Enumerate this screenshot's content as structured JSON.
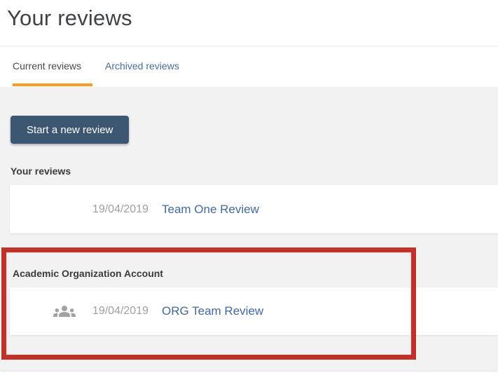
{
  "page": {
    "title": "Your reviews"
  },
  "tabs": [
    {
      "label": "Current reviews",
      "active": true
    },
    {
      "label": "Archived reviews",
      "active": false
    }
  ],
  "toolbar": {
    "start_review_label": "Start a new review"
  },
  "sections": [
    {
      "heading": "Your reviews",
      "rows": [
        {
          "icon": null,
          "date": "19/04/2019",
          "title": "Team One Review"
        }
      ]
    },
    {
      "heading": "Academic Organization Account",
      "rows": [
        {
          "icon": "group-icon",
          "date": "19/04/2019",
          "title": "ORG Team Review"
        }
      ]
    }
  ],
  "annotation": {
    "type": "highlight-box",
    "color": "#c03127"
  },
  "colors": {
    "tab_active_underline": "#f59d25",
    "inactive_tab_link": "#4b6d9d",
    "button_background": "#3d5671",
    "review_link": "#44689b",
    "date_text": "#9ca0a5",
    "panel_background": "#f2f2f3",
    "icon_gray": "#a2a2a2"
  }
}
